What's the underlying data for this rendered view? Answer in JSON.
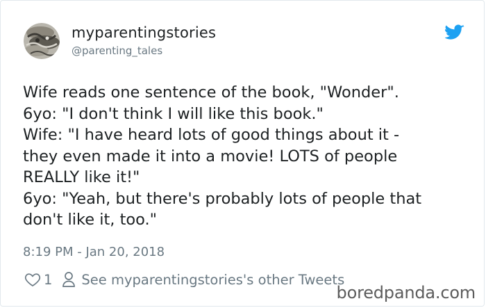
{
  "user": {
    "display_name": "myparentingstories",
    "handle": "@parenting_tales",
    "avatar_icon": "profile-photo"
  },
  "tweet": {
    "lines": [
      "Wife reads one sentence of the book, \"Wonder\".",
      "6yo: \"I don't think I will like this book.\"",
      "Wife: \"I have heard lots of good things about it -",
      "they even made it into a movie!  LOTS of people",
      "REALLY like it!\"",
      "6yo: \"Yeah, but there's probably lots of people that",
      "don't like it, too.\""
    ],
    "timestamp": "8:19 PM - Jan 20, 2018"
  },
  "actions": {
    "like_icon": "heart-icon",
    "like_count": "1",
    "profile_icon": "person-icon",
    "other_tweets_label": "See myparentingstories's other Tweets"
  },
  "brand": {
    "twitter_icon": "twitter-bird-icon",
    "twitter_color": "#1da1f2",
    "watermark": "boredpanda.com"
  }
}
